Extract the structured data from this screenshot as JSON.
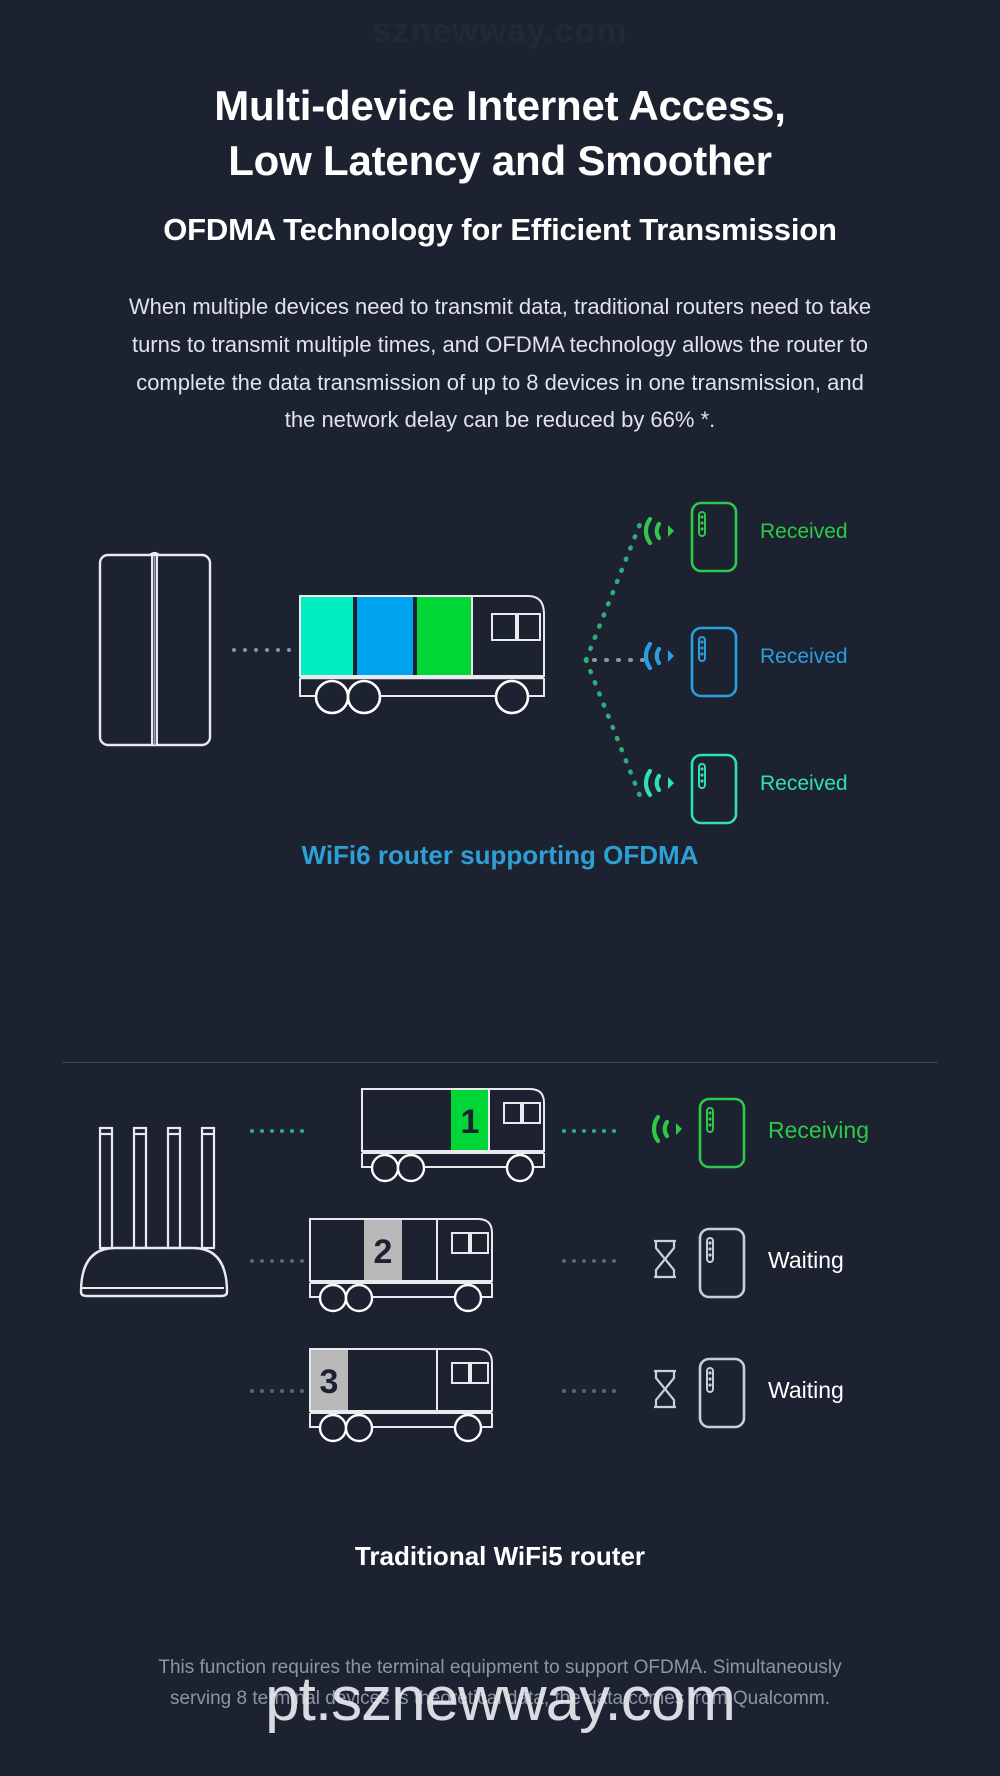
{
  "watermarks": {
    "top": "sznewway.com",
    "bottom": "pt.sznewway.com"
  },
  "heading": {
    "line1": "Multi-device Internet Access,",
    "line2": "Low Latency and Smoother",
    "subtitle": "OFDMA Technology for Efficient Transmission"
  },
  "body": "When multiple devices need to transmit data, traditional routers need to take turns to transmit multiple times, and OFDMA technology allows the router to complete the data transmission of up to 8 devices in one transmission, and the network delay can be reduced by 66% *.",
  "colors": {
    "background": "#1c2230",
    "outline": "#ffffff",
    "cyan": "#00efc1",
    "blue": "#00a3f0",
    "green": "#00d635",
    "caption_blue": "#2e9fd4",
    "muted": "#8c95a6",
    "grey_block": "#b9b9b9"
  },
  "wifi6": {
    "caption": "WiFi6 router supporting OFDMA",
    "router_name": "wifi6-router",
    "cargo": [
      {
        "color": "#00efc1",
        "name": "cargo-cyan"
      },
      {
        "color": "#00a3f0",
        "name": "cargo-blue"
      },
      {
        "color": "#00d635",
        "name": "cargo-green"
      }
    ],
    "devices": [
      {
        "status": "Received",
        "color": "#2ec94a",
        "name": "device-green"
      },
      {
        "status": "Received",
        "color": "#2a9fe0",
        "name": "device-blue"
      },
      {
        "status": "Received",
        "color": "#2ee0b4",
        "name": "device-cyan"
      }
    ]
  },
  "wifi5": {
    "caption": "Traditional WiFi5 router",
    "router_name": "wifi5-router",
    "rows": [
      {
        "number": "1",
        "block_color": "#00d635",
        "number_color": "#1c2230",
        "status": "Receiving",
        "status_color": "#2ec94a",
        "icon": "wifi-signal-icon",
        "device_color": "#2ec94a"
      },
      {
        "number": "2",
        "block_color": "#b9b9b9",
        "number_color": "#1c2230",
        "status": "Waiting",
        "status_color": "#ffffff",
        "icon": "hourglass-icon",
        "device_color": "#c9cfda"
      },
      {
        "number": "3",
        "block_color": "#b9b9b9",
        "number_color": "#1c2230",
        "status": "Waiting",
        "status_color": "#ffffff",
        "icon": "hourglass-icon",
        "device_color": "#c9cfda"
      }
    ]
  },
  "footnote": {
    "line1": "This function requires the terminal equipment to support OFDMA. Simultaneously",
    "line2": "serving 8 terminal devices is theoretical data, the data comes from Qualcomm."
  }
}
